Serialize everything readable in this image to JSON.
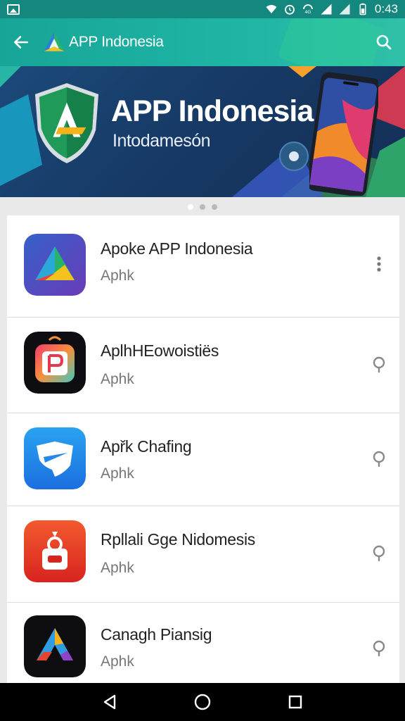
{
  "status_bar": {
    "time": "0:43",
    "icons": [
      "gallery-icon",
      "wifi-icon",
      "alarm-icon",
      "data-icon",
      "signal-icon",
      "signal-icon",
      "battery-icon"
    ]
  },
  "app_bar": {
    "title": "APP Indonesia",
    "back_icon": "arrow-left-icon",
    "search_icon": "search-icon"
  },
  "banner": {
    "title": "APP Indonesia",
    "subtitle": "Intodamesón"
  },
  "carousel": {
    "pages": 3,
    "active": 0
  },
  "apps": [
    {
      "name": "Apoke APP Indonesia",
      "sub": "Aphk",
      "action_icon": "more-vertical-icon"
    },
    {
      "name": "AplhHEowoistiës",
      "sub": "Aphk",
      "action_icon": "pin-icon"
    },
    {
      "name": "Apřk Chafing",
      "sub": "Aphk",
      "action_icon": "pin-icon"
    },
    {
      "name": "Rpllali Gge Nidomesis",
      "sub": "Aphk",
      "action_icon": "pin-icon"
    },
    {
      "name": "Canagh Piansig",
      "sub": "Aphk",
      "action_icon": "pin-icon"
    }
  ],
  "nav": {
    "back": "nav-back-icon",
    "home": "nav-home-icon",
    "recents": "nav-recents-icon"
  },
  "colors": {
    "app_bar": "#1fb5a4",
    "status_bar": "#14877e",
    "banner_bg": "#173a66"
  }
}
